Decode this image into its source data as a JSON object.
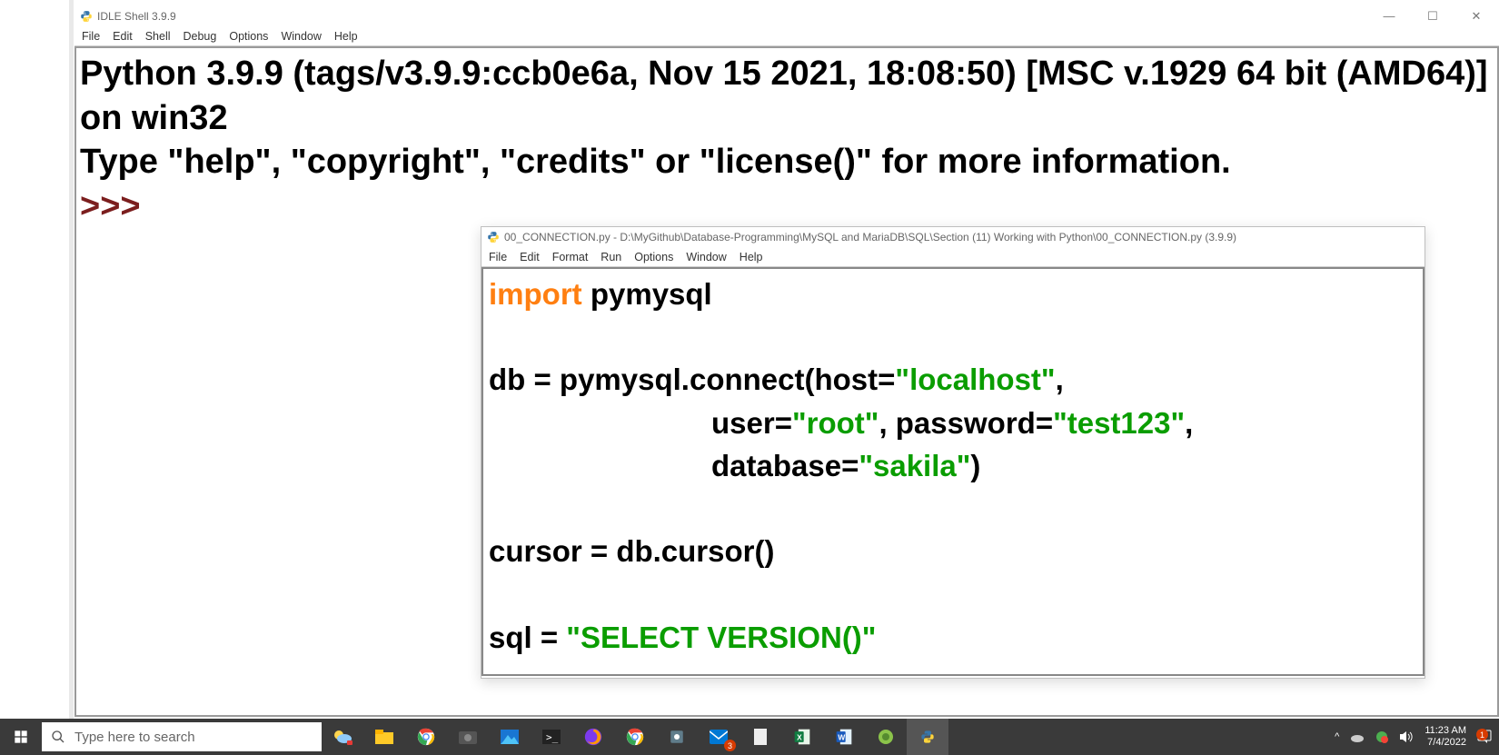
{
  "shell": {
    "title": "IDLE Shell 3.9.9",
    "menu": [
      "File",
      "Edit",
      "Shell",
      "Debug",
      "Options",
      "Window",
      "Help"
    ],
    "banner_line1": "Python 3.9.9 (tags/v3.9.9:ccb0e6a, Nov 15 2021, 18:08:50) [MSC v.1929 64 bit (AMD64)] on win32",
    "banner_line2": "Type \"help\", \"copyright\", \"credits\" or \"license()\" for more information.",
    "prompt": ">>>"
  },
  "editor": {
    "title": "00_CONNECTION.py - D:\\MyGithub\\Database-Programming\\MySQL and MariaDB\\SQL\\Section (11) Working with Python\\00_CONNECTION.py (3.9.9)",
    "menu": [
      "File",
      "Edit",
      "Format",
      "Run",
      "Options",
      "Window",
      "Help"
    ],
    "code": {
      "import_kw": "import",
      "import_mod": " pymysql",
      "l_db": "db = pymysql.connect(host=",
      "s_host": "\"localhost\"",
      "l_user": "user=",
      "s_user": "\"root\"",
      "l_pw": ", password=",
      "s_pw": "\"test123\"",
      "l_dbk": "database=",
      "s_db": "\"sakila\"",
      "close_paren": ")",
      "comma": ",",
      "cursor": "cursor = db.cursor()",
      "sql_l": "sql = ",
      "sql_s": "\"SELECT VERSION()\""
    }
  },
  "taskbar": {
    "search_placeholder": "Type here to search",
    "time": "11:23 AM",
    "date": "7/4/2022",
    "mail_badge": "3",
    "notif_badge": "1"
  }
}
